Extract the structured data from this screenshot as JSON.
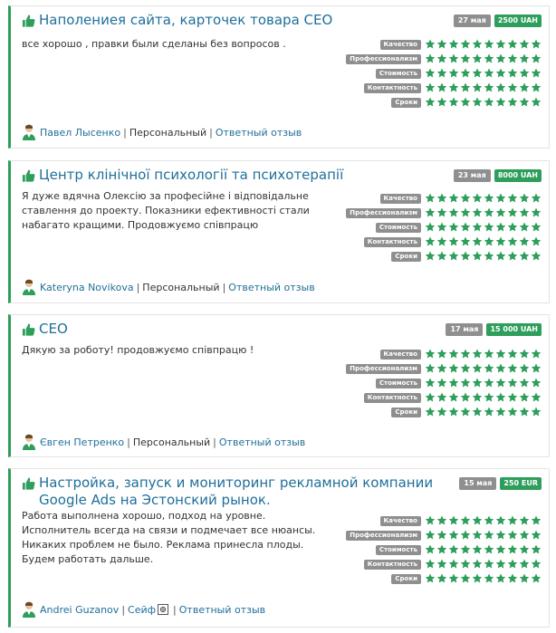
{
  "rating_labels": [
    "Качество",
    "Профессионализм",
    "Стоимость",
    "Контактность",
    "Сроки"
  ],
  "stars_per_rating": 10,
  "reviews": [
    {
      "title": "Наполениея сайта, карточек товара СЕО",
      "date": "27 мая",
      "price": "2500 UAH",
      "text": "все хорошо , правки были сделаны без вопросов .",
      "author": "Павел Лысенко",
      "type": "Персональный",
      "reply": "Ответный отзыв"
    },
    {
      "title": "Центр клінічної психології та психотерапії",
      "date": "23 мая",
      "price": "8000 UAH",
      "text": "Я дуже вдячна Олексію за професійне і відповідальне ставлення до проекту. Показники ефективності стали набагато кращими. Продовжуємо співпрацю",
      "author": "Kateryna Novikova",
      "type": "Персональный",
      "reply": "Ответный отзыв"
    },
    {
      "title": "СЕО",
      "date": "17 мая",
      "price": "15 000 UAH",
      "text": "Дякую за роботу! продовжуємо співпрацю !",
      "author": "Євген Петренко",
      "type": "Персональный",
      "reply": "Ответный отзыв"
    },
    {
      "title": "Настройка, запуск и мониторинг рекламной компании Google Ads на Эстонский рынок.",
      "date": "15 мая",
      "price": "250 EUR",
      "text": "Работа выполнена хорошо, подход на уровне. Исполнитель всегда на связи и подмечает все нюансы. Никаких проблем не было. Реклама принесла плоды. Будем работать дальше.",
      "author": "Andrei Guzanov",
      "type": "Сейф",
      "reply": "Ответный отзыв"
    }
  ],
  "colors": {
    "accent": "#2e9e5b",
    "link": "#1f6f9a",
    "badge": "#8f8f8f"
  }
}
